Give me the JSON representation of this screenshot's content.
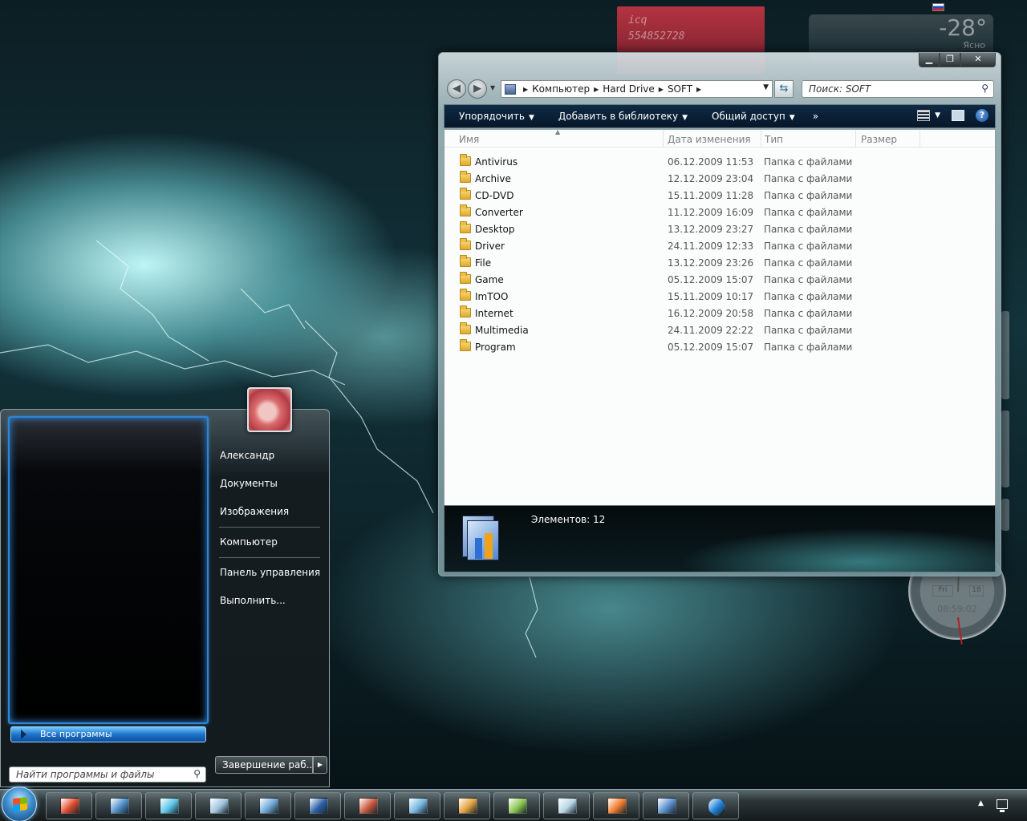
{
  "desktop": {
    "icq": {
      "title": "icq",
      "number": "554852728"
    },
    "weather": {
      "temp": "-28°",
      "condition": "Ясно"
    },
    "clock": {
      "day": "Fri",
      "date": "18",
      "time": "08:59:02"
    }
  },
  "explorer": {
    "nav": {
      "back_symbol": "◀",
      "forward_symbol": "▶",
      "breadcrumbs": [
        "Компьютер",
        "Hard Drive",
        "SOFT"
      ],
      "search_placeholder": "Поиск: SOFT"
    },
    "toolbar": {
      "organize": "Упорядочить",
      "add_to_library": "Добавить в библиотеку",
      "share": "Общий доступ",
      "more": "»",
      "help": "?"
    },
    "columns": {
      "name": "Имя",
      "date": "Дата изменения",
      "type": "Тип",
      "size": "Размер"
    },
    "files": [
      {
        "name": "Antivirus",
        "date": "06.12.2009 11:53",
        "type": "Папка с файлами"
      },
      {
        "name": "Archive",
        "date": "12.12.2009 23:04",
        "type": "Папка с файлами"
      },
      {
        "name": "CD-DVD",
        "date": "15.11.2009 11:28",
        "type": "Папка с файлами"
      },
      {
        "name": "Converter",
        "date": "11.12.2009 16:09",
        "type": "Папка с файлами"
      },
      {
        "name": "Desktop",
        "date": "13.12.2009 23:27",
        "type": "Папка с файлами"
      },
      {
        "name": "Driver",
        "date": "24.11.2009 12:33",
        "type": "Папка с файлами"
      },
      {
        "name": "File",
        "date": "13.12.2009 23:26",
        "type": "Папка с файлами"
      },
      {
        "name": "Game",
        "date": "05.12.2009 15:07",
        "type": "Папка с файлами"
      },
      {
        "name": "ImTOO",
        "date": "15.11.2009 10:17",
        "type": "Папка с файлами"
      },
      {
        "name": "Internet",
        "date": "16.12.2009 20:58",
        "type": "Папка с файлами"
      },
      {
        "name": "Multimedia",
        "date": "24.11.2009 22:22",
        "type": "Папка с файлами"
      },
      {
        "name": "Program",
        "date": "05.12.2009 15:07",
        "type": "Папка с файлами"
      }
    ],
    "status": {
      "item_count": "Элементов: 12"
    }
  },
  "start_menu": {
    "all_programs": "Все программы",
    "search_placeholder": "Найти программы и файлы",
    "user": "Александр",
    "documents": "Документы",
    "pictures": "Изображения",
    "computer": "Компьютер",
    "control_panel": "Панель управления",
    "run": "Выполнить...",
    "shutdown": "Завершение раб..."
  },
  "taskbar": {
    "buttons": [
      {
        "icon": "media-center-icon",
        "color": "#e04a2a"
      },
      {
        "icon": "explorer-icon",
        "color": "#4d8fc9"
      },
      {
        "icon": "network-icon",
        "color": "#5ac4e8"
      },
      {
        "icon": "documents-icon",
        "color": "#9fc3de"
      },
      {
        "icon": "mail-icon",
        "color": "#6ea9d6"
      },
      {
        "icon": "dvd-icon",
        "color": "#2a5fa8"
      },
      {
        "icon": "video-icon",
        "color": "#c9563a"
      },
      {
        "icon": "monitor-icon",
        "color": "#76b6e0"
      },
      {
        "icon": "paint-icon",
        "color": "#e2a03c"
      },
      {
        "icon": "picture-icon",
        "color": "#8bc64f"
      },
      {
        "icon": "window-icon",
        "color": "#b8d4e6"
      },
      {
        "icon": "photo-icon",
        "color": "#f07a2a"
      },
      {
        "icon": "tools-icon",
        "color": "#5b8fcf"
      },
      {
        "icon": "teamviewer-icon",
        "color": "#1e7fd8"
      }
    ]
  }
}
